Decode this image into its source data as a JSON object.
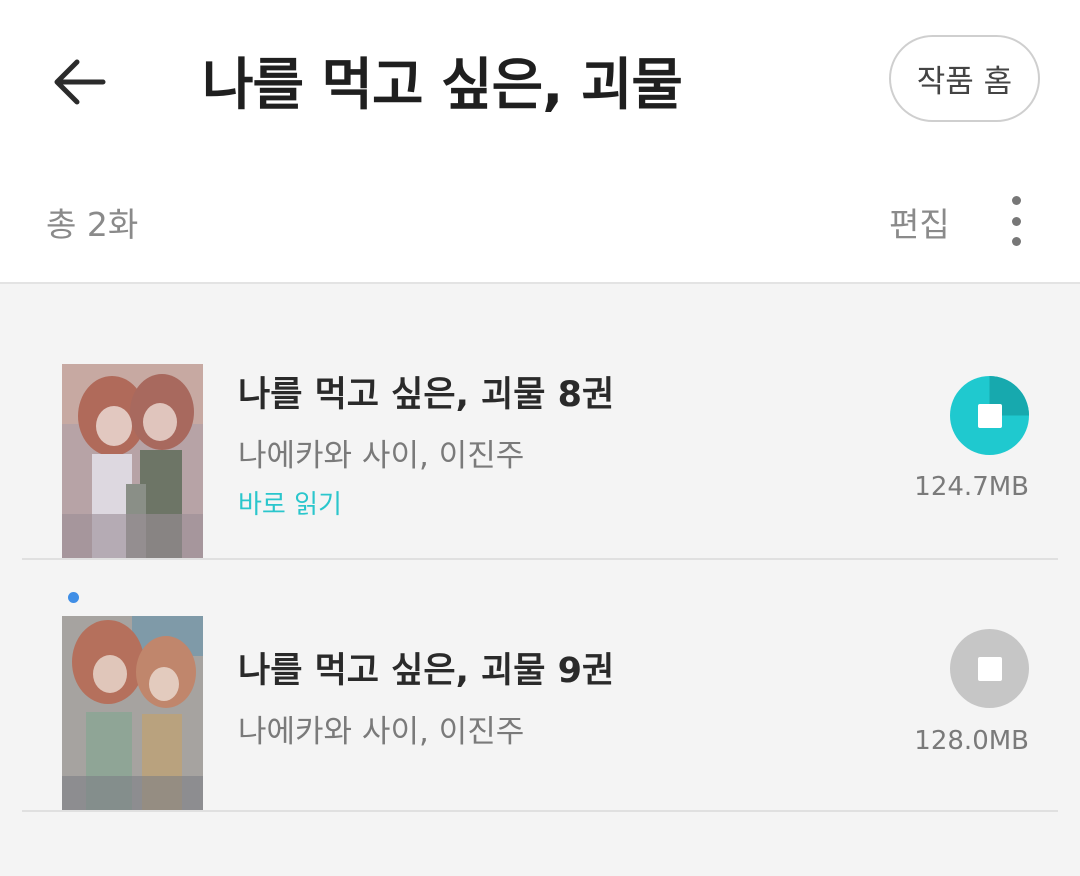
{
  "header": {
    "title": "나를 먹고 싶은, 괴물",
    "home_button": "작품 홈"
  },
  "toolbar": {
    "count": "총 2화",
    "edit": "편집"
  },
  "episodes": [
    {
      "title": "나를 먹고 싶은, 괴물 8권",
      "author": "나에카와 사이, 이진주",
      "read_label": "바로 읽기",
      "size": "124.7MB",
      "download_progress": 0.25,
      "status_color": "#1fc9cf"
    },
    {
      "title": "나를 먹고 싶은, 괴물 9권",
      "author": "나에카와 사이, 이진주",
      "size": "128.0MB",
      "download_progress": 0,
      "status_color": "#c6c6c6",
      "new_indicator_color": "#3f8ee6"
    }
  ]
}
